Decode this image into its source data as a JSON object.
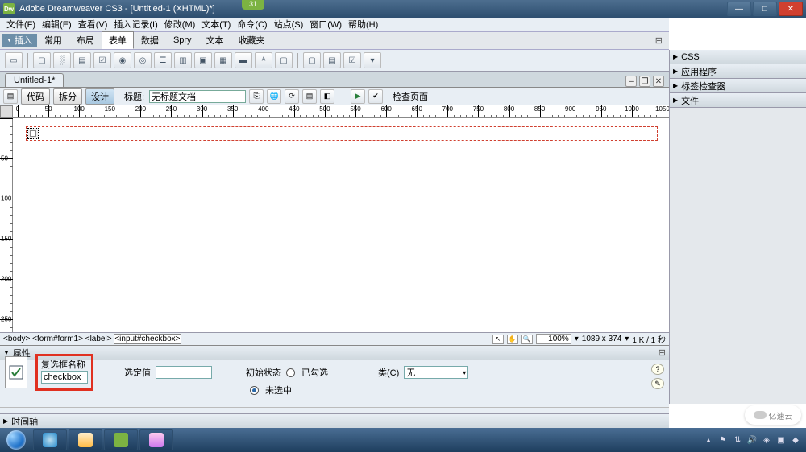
{
  "titlebar": {
    "app_icon_text": "Dw",
    "title": "Adobe Dreamweaver CS3 - [Untitled-1 (XHTML)*]",
    "overlay_tab": "31"
  },
  "menubar": {
    "items": [
      "文件(F)",
      "编辑(E)",
      "查看(V)",
      "插入记录(I)",
      "修改(M)",
      "文本(T)",
      "命令(C)",
      "站点(S)",
      "窗口(W)",
      "帮助(H)"
    ]
  },
  "insert_bar": {
    "label": "插入",
    "tabs": [
      "常用",
      "布局",
      "表单",
      "数据",
      "Spry",
      "文本",
      "收藏夹"
    ],
    "active_index": 2
  },
  "document": {
    "tab_label": "Untitled-1*",
    "views": {
      "code": "代码",
      "split": "拆分",
      "design": "设计",
      "active": "design"
    },
    "title_label": "标题:",
    "title_value": "无标题文档",
    "check_label": "检查页面"
  },
  "ruler": {
    "start": 0,
    "end": 1050,
    "step": 50
  },
  "tag_selector": {
    "path": [
      "<body>",
      "<form#form1>",
      "<label>",
      "<input#checkbox>"
    ],
    "selected_index": 3
  },
  "statusbar": {
    "zoom": "100%",
    "dims": "1089 x 374",
    "size_time": "1 K / 1 秒"
  },
  "properties": {
    "header": "属性",
    "name_label": "复选框名称",
    "name_value": "checkbox",
    "checked_value_label": "选定值",
    "checked_value": "",
    "init_state_label": "初始状态",
    "state_checked": "已勾选",
    "state_unchecked": "未选中",
    "selected_state": "unchecked",
    "class_label": "类(C)",
    "class_value": "无"
  },
  "timeline": {
    "header": "时间轴"
  },
  "right_panels": {
    "items": [
      "CSS",
      "应用程序",
      "标签检查器",
      "文件"
    ]
  },
  "watermark": {
    "text": "亿速云"
  },
  "icons": {
    "min": "—",
    "max": "□",
    "close": "✕",
    "tri_down": "▼",
    "tri_right": "▶",
    "expand": "⊟",
    "arr_down": "▾",
    "pointer": "↖",
    "hand": "✋",
    "zoom_tool": "🔍",
    "help": "?",
    "refresh": "⟳"
  }
}
